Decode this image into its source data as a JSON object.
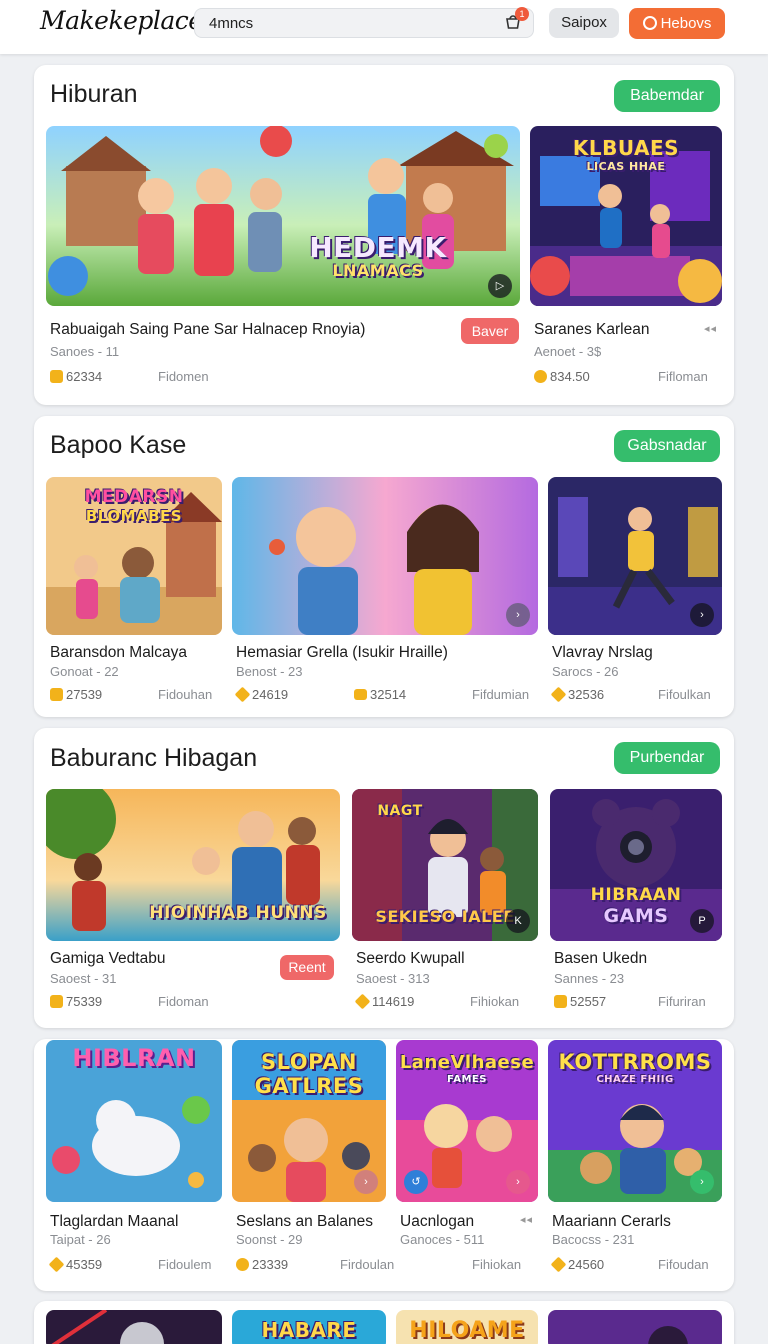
{
  "header": {
    "logo": "Makekeplace",
    "search_value": "4mncs",
    "cart_count": "1",
    "signin_label": "Saipox",
    "action_label": "Hebovs"
  },
  "sections": [
    {
      "title": "Hiburan",
      "button": "Babemdar",
      "cards": [
        {
          "title": "Rabuaigah Saing  Pane Sar Halnacep Rnoyia)",
          "sub": "Sanoes - 11",
          "price": "62334",
          "category": "Fidomen",
          "tag": "Baver",
          "thumb_text": [
            "HEDEMK",
            "LNAMACS"
          ]
        },
        {
          "title": "Saranes Karlean",
          "sub": "Aenoet - 3$",
          "price": "834.50",
          "category": "Fifloman",
          "dots": "◂◂",
          "thumb_text": [
            "KLBUAES",
            "LICAS HHAE"
          ]
        }
      ]
    },
    {
      "title": "Bapoo Kase",
      "button": "Gabsnadar",
      "cards": [
        {
          "title": "Baransdon Malcaya",
          "sub": "Gonoat - 22",
          "price": "27539",
          "category": "Fidouhan",
          "thumb_text": [
            "MEDARSN",
            "BLOMABES"
          ]
        },
        {
          "title": "Hemasiar Grella (Isukir Hraille)",
          "sub": "Benost - 23",
          "price": "24619",
          "price2": "32514",
          "category": "Fifdumian",
          "thumb_text": []
        },
        {
          "title": "Vlavray Nrslag",
          "sub": "Sarocs - 26",
          "price": "32536",
          "category": "Fifoulkan",
          "thumb_text": []
        }
      ]
    },
    {
      "title": "Baburanc Hibagan",
      "button": "Purbendar",
      "cards": [
        {
          "title": "Gamiga Vedtabu",
          "sub": "Saoest - 31",
          "price": "75339",
          "category": "Fidoman",
          "tag": "Reent",
          "thumb_text": [
            "HIOINHAB HUNNS"
          ]
        },
        {
          "title": "Seerdo Kwupall",
          "sub": "Saoest - 313",
          "price": "114619",
          "category": "Fihiokan",
          "thumb_text": [
            "NAGT",
            "SEKIESO IALEE"
          ]
        },
        {
          "title": "Basen Ukedn",
          "sub": "Sannes - 23",
          "price": "52557",
          "category": "Fifuriran",
          "thumb_text": [
            "HIBRAAN",
            "GAMS"
          ]
        }
      ]
    },
    {
      "title": "",
      "button": "",
      "cards": [
        {
          "title": "Tlaglardan Maanal",
          "sub": "Taipat - 26",
          "price": "45359",
          "category": "Fidoulem",
          "thumb_text": [
            "HIBLRAN"
          ]
        },
        {
          "title": "Seslans  an Balanes",
          "sub": "Soonst - 29",
          "price": "23339",
          "category": "Firdoulan",
          "thumb_text": [
            "SLOPAN",
            "GATLRES"
          ]
        },
        {
          "title": "Uacnlogan",
          "sub": "Ganoces - 511",
          "price": "",
          "category": "Fihiokan",
          "dots": "◂◂",
          "thumb_text": [
            "LaneVlhaese",
            "FAMES"
          ]
        },
        {
          "title": "Maariann Cerarls",
          "sub": "Bacocss - 231",
          "price": "24560",
          "category": "Fifoudan",
          "thumb_text": [
            "KOTTRROMS",
            "CHAZE FHIIG"
          ]
        }
      ]
    },
    {
      "title": "",
      "button": "",
      "cards": [
        {
          "thumb_text": []
        },
        {
          "thumb_text": [
            "HABARE"
          ]
        },
        {
          "thumb_text": [
            "HILOAME"
          ]
        },
        {
          "thumb_text": []
        }
      ]
    }
  ]
}
